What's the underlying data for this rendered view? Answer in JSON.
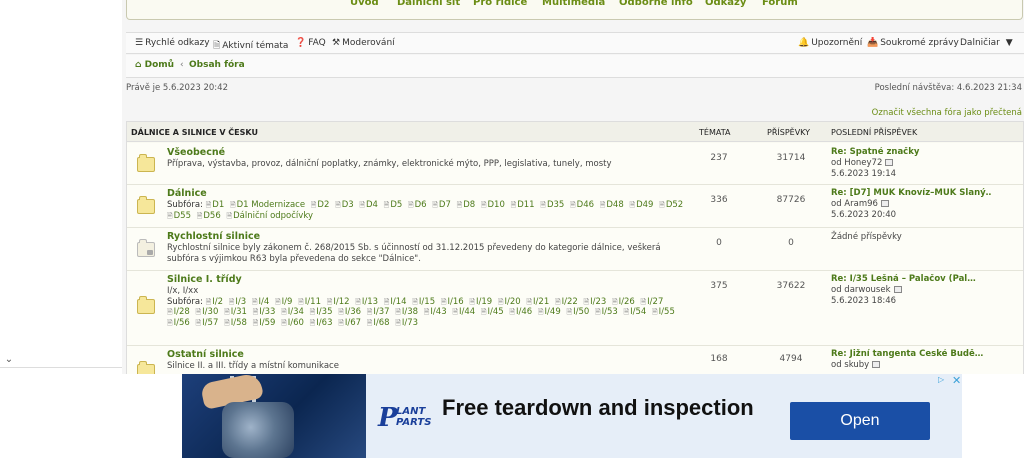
{
  "top_nav": [
    "Úvod",
    "Dálniční síť",
    "Pro řidiče",
    "Multimédia",
    "Odborné info",
    "Odkazy",
    "Fórum"
  ],
  "quick_bar": {
    "left": [
      {
        "icon": "menu-icon",
        "label": "Rychlé odkazy"
      },
      {
        "icon": "file-icon",
        "label": "Aktivní témata"
      },
      {
        "icon": "question-icon",
        "label": "FAQ"
      },
      {
        "icon": "hammer-icon",
        "label": "Moderování"
      }
    ],
    "right": [
      {
        "icon": "bell-icon",
        "label": "Upozornění"
      },
      {
        "icon": "inbox-icon",
        "label": "Soukromé zprávy"
      },
      {
        "icon": "",
        "label": "Dalničiar"
      }
    ]
  },
  "breadcrumb": {
    "home": "Domů",
    "separator": "‹",
    "current": "Obsah fóra"
  },
  "meta": {
    "now": "Právě je 5.6.2023 20:42",
    "last_visit": "Poslední návštěva: 4.6.2023 21:34",
    "mark_read": "Označit všechna fóra jako přečtená"
  },
  "forum_table": {
    "headers": {
      "section": "DÁLNICE A SILNICE V ČESKU",
      "topics": "TÉMATA",
      "posts": "PŘÍSPĚVKY",
      "last": "POSLEDNÍ PŘÍSPĚVEK"
    },
    "rows": [
      {
        "title": "Všeobecné",
        "desc": "Příprava, výstavba, provoz, dálniční poplatky, známky, elektronické mýto, PPP, legislativa, tunely, mosty",
        "subforums_label": "",
        "subforums": [],
        "topics": "237",
        "posts": "31714",
        "last_title": "Re: Špatné značky",
        "last_by": "od Honey72",
        "last_date": "5.6.2023 19:14"
      },
      {
        "title": "Dálnice",
        "desc": "",
        "subforums_label": "Subfóra:",
        "subforums": [
          "D1",
          "D1 Modernizace",
          "D2",
          "D3",
          "D4",
          "D5",
          "D6",
          "D7",
          "D8",
          "D10",
          "D11",
          "D35",
          "D46",
          "D48",
          "D49",
          "D52",
          "D55",
          "D56",
          "Dálniční odpočívky"
        ],
        "topics": "336",
        "posts": "87726",
        "last_title": "Re: [D7] MÚK Knovíz–MÚK Slaný…",
        "last_by": "od Aram96",
        "last_date": "5.6.2023 20:40"
      },
      {
        "title": "Rychlostní silnice",
        "desc": "Rychlostní silnice byly zákonem č. 268/2015 Sb. s účinností od 31.12.2015 převedeny do kategorie dálnice, veškerá subfóra s výjimkou R63 byla převedena do sekce \"Dálnice\".",
        "subforums_label": "",
        "subforums": [],
        "topics": "0",
        "posts": "0",
        "last_title": "Žádné příspěvky",
        "last_by": "",
        "last_date": ""
      },
      {
        "title": "Silnice I. třídy",
        "desc": "I/x, I/xx",
        "subforums_label": "Subfóra:",
        "subforums": [
          "I/2",
          "I/3",
          "I/4",
          "I/9",
          "I/11",
          "I/12",
          "I/13",
          "I/14",
          "I/15",
          "I/16",
          "I/19",
          "I/20",
          "I/21",
          "I/22",
          "I/23",
          "I/26",
          "I/27",
          "I/28",
          "I/30",
          "I/31",
          "I/33",
          "I/34",
          "I/35",
          "I/36",
          "I/37",
          "I/38",
          "I/43",
          "I/44",
          "I/45",
          "I/46",
          "I/49",
          "I/50",
          "I/53",
          "I/54",
          "I/55",
          "I/56",
          "I/57",
          "I/58",
          "I/59",
          "I/60",
          "I/63",
          "I/67",
          "I/68",
          "I/73"
        ],
        "topics": "375",
        "posts": "37622",
        "last_title": "Re: I/35 Lešná – Palačov (Pal…",
        "last_by": "od darwousek",
        "last_date": "5.6.2023 18:46"
      },
      {
        "title": "Ostatní silnice",
        "desc": "Silnice II. a III. třídy a místní komunikace",
        "subforums_label": "",
        "subforums": [],
        "topics": "168",
        "posts": "4794",
        "last_title": "Re: Jižní tangenta České Budě…",
        "last_by": "od skuby",
        "last_date": ""
      }
    ]
  },
  "ad": {
    "brand_top": "LANT",
    "brand_bottom": "PARTS",
    "brand_initial": "P",
    "headline": "Free teardown and inspection",
    "cta": "Open"
  },
  "colors": {
    "accent": "#6b8d15",
    "link": "#4d7a1a",
    "ad_button": "#1a4fa6"
  }
}
